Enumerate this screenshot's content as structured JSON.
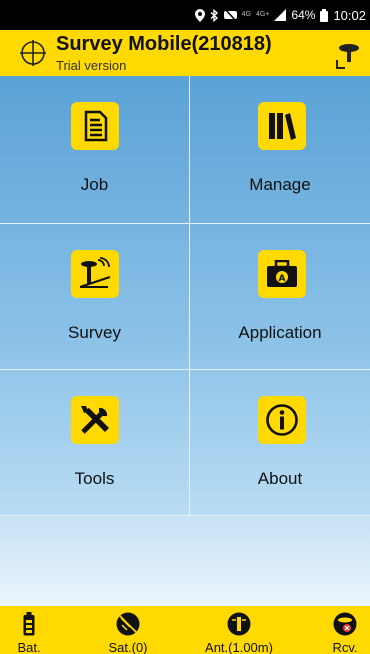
{
  "status_bar": {
    "network_top": "4G",
    "network_bottom": "4G+",
    "battery": "64%",
    "time": "10:02"
  },
  "header": {
    "title": "Survey Mobile(210818)",
    "subtitle": "Trial version"
  },
  "menu": [
    {
      "label": "Job",
      "icon": "document-icon"
    },
    {
      "label": "Manage",
      "icon": "books-icon"
    },
    {
      "label": "Survey",
      "icon": "survey-rover-icon"
    },
    {
      "label": "Application",
      "icon": "toolbox-icon"
    },
    {
      "label": "Tools",
      "icon": "wrench-screwdriver-icon"
    },
    {
      "label": "About",
      "icon": "info-icon"
    }
  ],
  "bottom_bar": {
    "battery": "Bat.",
    "satellites": "Sat.(0)",
    "antenna": "Ant.(1.00m)",
    "receiver": "Rcv."
  },
  "colors": {
    "accent": "#ffd900",
    "tile_top": "#5aa2d6",
    "tile_bottom": "#b9dcf3"
  }
}
